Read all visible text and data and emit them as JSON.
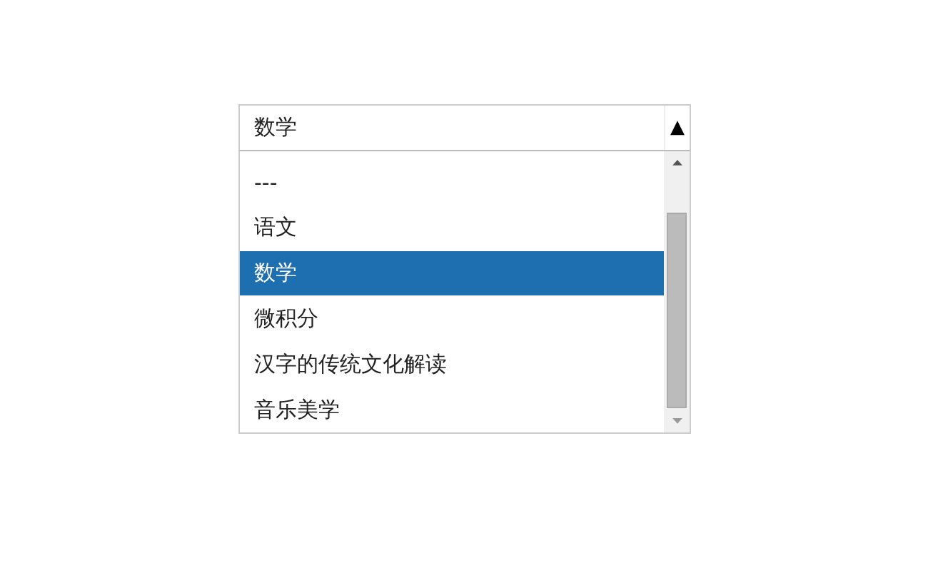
{
  "select": {
    "value": "数学",
    "toggle": "▲",
    "expanded": true,
    "options": [
      {
        "label": "---",
        "selected": false
      },
      {
        "label": "语文",
        "selected": false
      },
      {
        "label": "数学",
        "selected": true
      },
      {
        "label": "微积分",
        "selected": false
      },
      {
        "label": "汉字的传统文化解读",
        "selected": false
      },
      {
        "label": "音乐美学",
        "selected": false
      }
    ]
  }
}
